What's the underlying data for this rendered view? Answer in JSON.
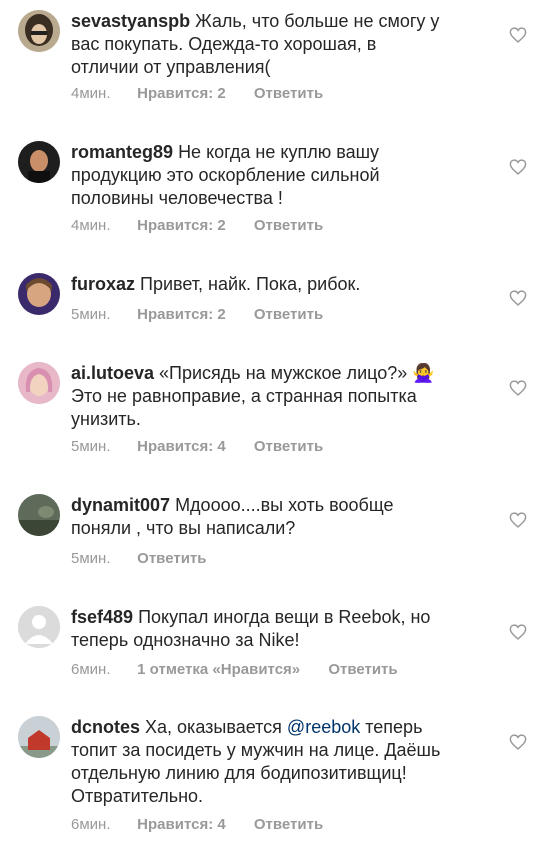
{
  "comments": [
    {
      "username": "sevastyanspb",
      "lines": [
        "Жаль, что больше не смогу у",
        "вас покупать. Одежда-то хорошая, в",
        "отличии от управления("
      ],
      "time": "4мин.",
      "likes": "Нравится: 2",
      "reply": "Ответить"
    },
    {
      "username": "romanteg89",
      "lines": [
        "Не когда не куплю вашу",
        "продукцию это оскорбление сильной",
        "половины человечества !"
      ],
      "time": "4мин.",
      "likes": "Нравится: 2",
      "reply": "Ответить"
    },
    {
      "username": "furoxaz",
      "lines": [
        "Привет, найк. Пока, рибок."
      ],
      "time": "5мин.",
      "likes": "Нравится: 2",
      "reply": "Ответить"
    },
    {
      "username": "ai.lutoeva",
      "lines": [
        "«Присядь на мужское лицо?» 🙅‍♀️",
        "Это не равноправие, а странная попытка",
        "унизить."
      ],
      "time": "5мин.",
      "likes": "Нравится: 4",
      "reply": "Ответить"
    },
    {
      "username": "dynamit007",
      "lines": [
        "Мдоооо....вы хоть вообще",
        "поняли , что вы написали?"
      ],
      "time": "5мин.",
      "likes": "",
      "reply": "Ответить"
    },
    {
      "username": "fsef489",
      "lines": [
        "Покупал иногда вещи в Reebok, но",
        "теперь однозначно за Nike!"
      ],
      "time": "6мин.",
      "likes": "1 отметка «Нравится»",
      "reply": "Ответить"
    },
    {
      "username": "dcnotes",
      "line1_prefix": "Ха, оказывается",
      "mention": "@reebok",
      "line1_suffix": "теперь",
      "lines": [
        "топит за посидеть у мужчин на лице. Даёшь",
        "отдельную линию для бодипозитивщиц!",
        "Отвратительно."
      ],
      "time": "6мин.",
      "likes": "Нравится: 4",
      "reply": "Ответить"
    }
  ],
  "icons": {
    "like": "heart-outline-icon",
    "default_avatar": "default-avatar-icon"
  },
  "colors": {
    "text": "#262626",
    "meta": "#999999",
    "mention": "#003569"
  }
}
